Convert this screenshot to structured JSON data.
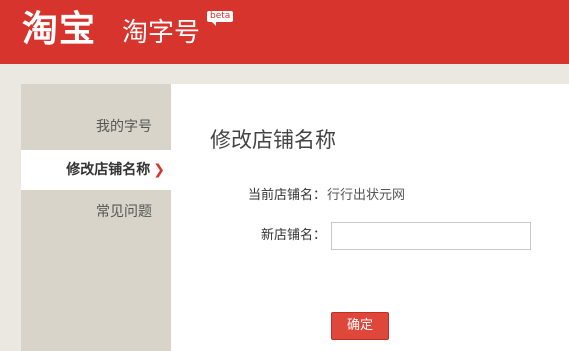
{
  "header": {
    "logo": "淘宝",
    "product_name": "淘字号",
    "badge": "beta",
    "background_color": "#d6342d"
  },
  "sidebar": {
    "items": [
      {
        "label": "我的字号",
        "active": false
      },
      {
        "label": "修改店铺名称",
        "active": true,
        "indicator": "chevron-right-icon"
      },
      {
        "label": "常见问题",
        "active": false
      }
    ]
  },
  "main": {
    "title": "修改店铺名称",
    "current_name_label": "当前店铺名：",
    "current_name_value": "行行出状元网",
    "new_name_label": "新店铺名：",
    "new_name_value": "",
    "new_name_placeholder": "",
    "confirm_label": "确定"
  }
}
